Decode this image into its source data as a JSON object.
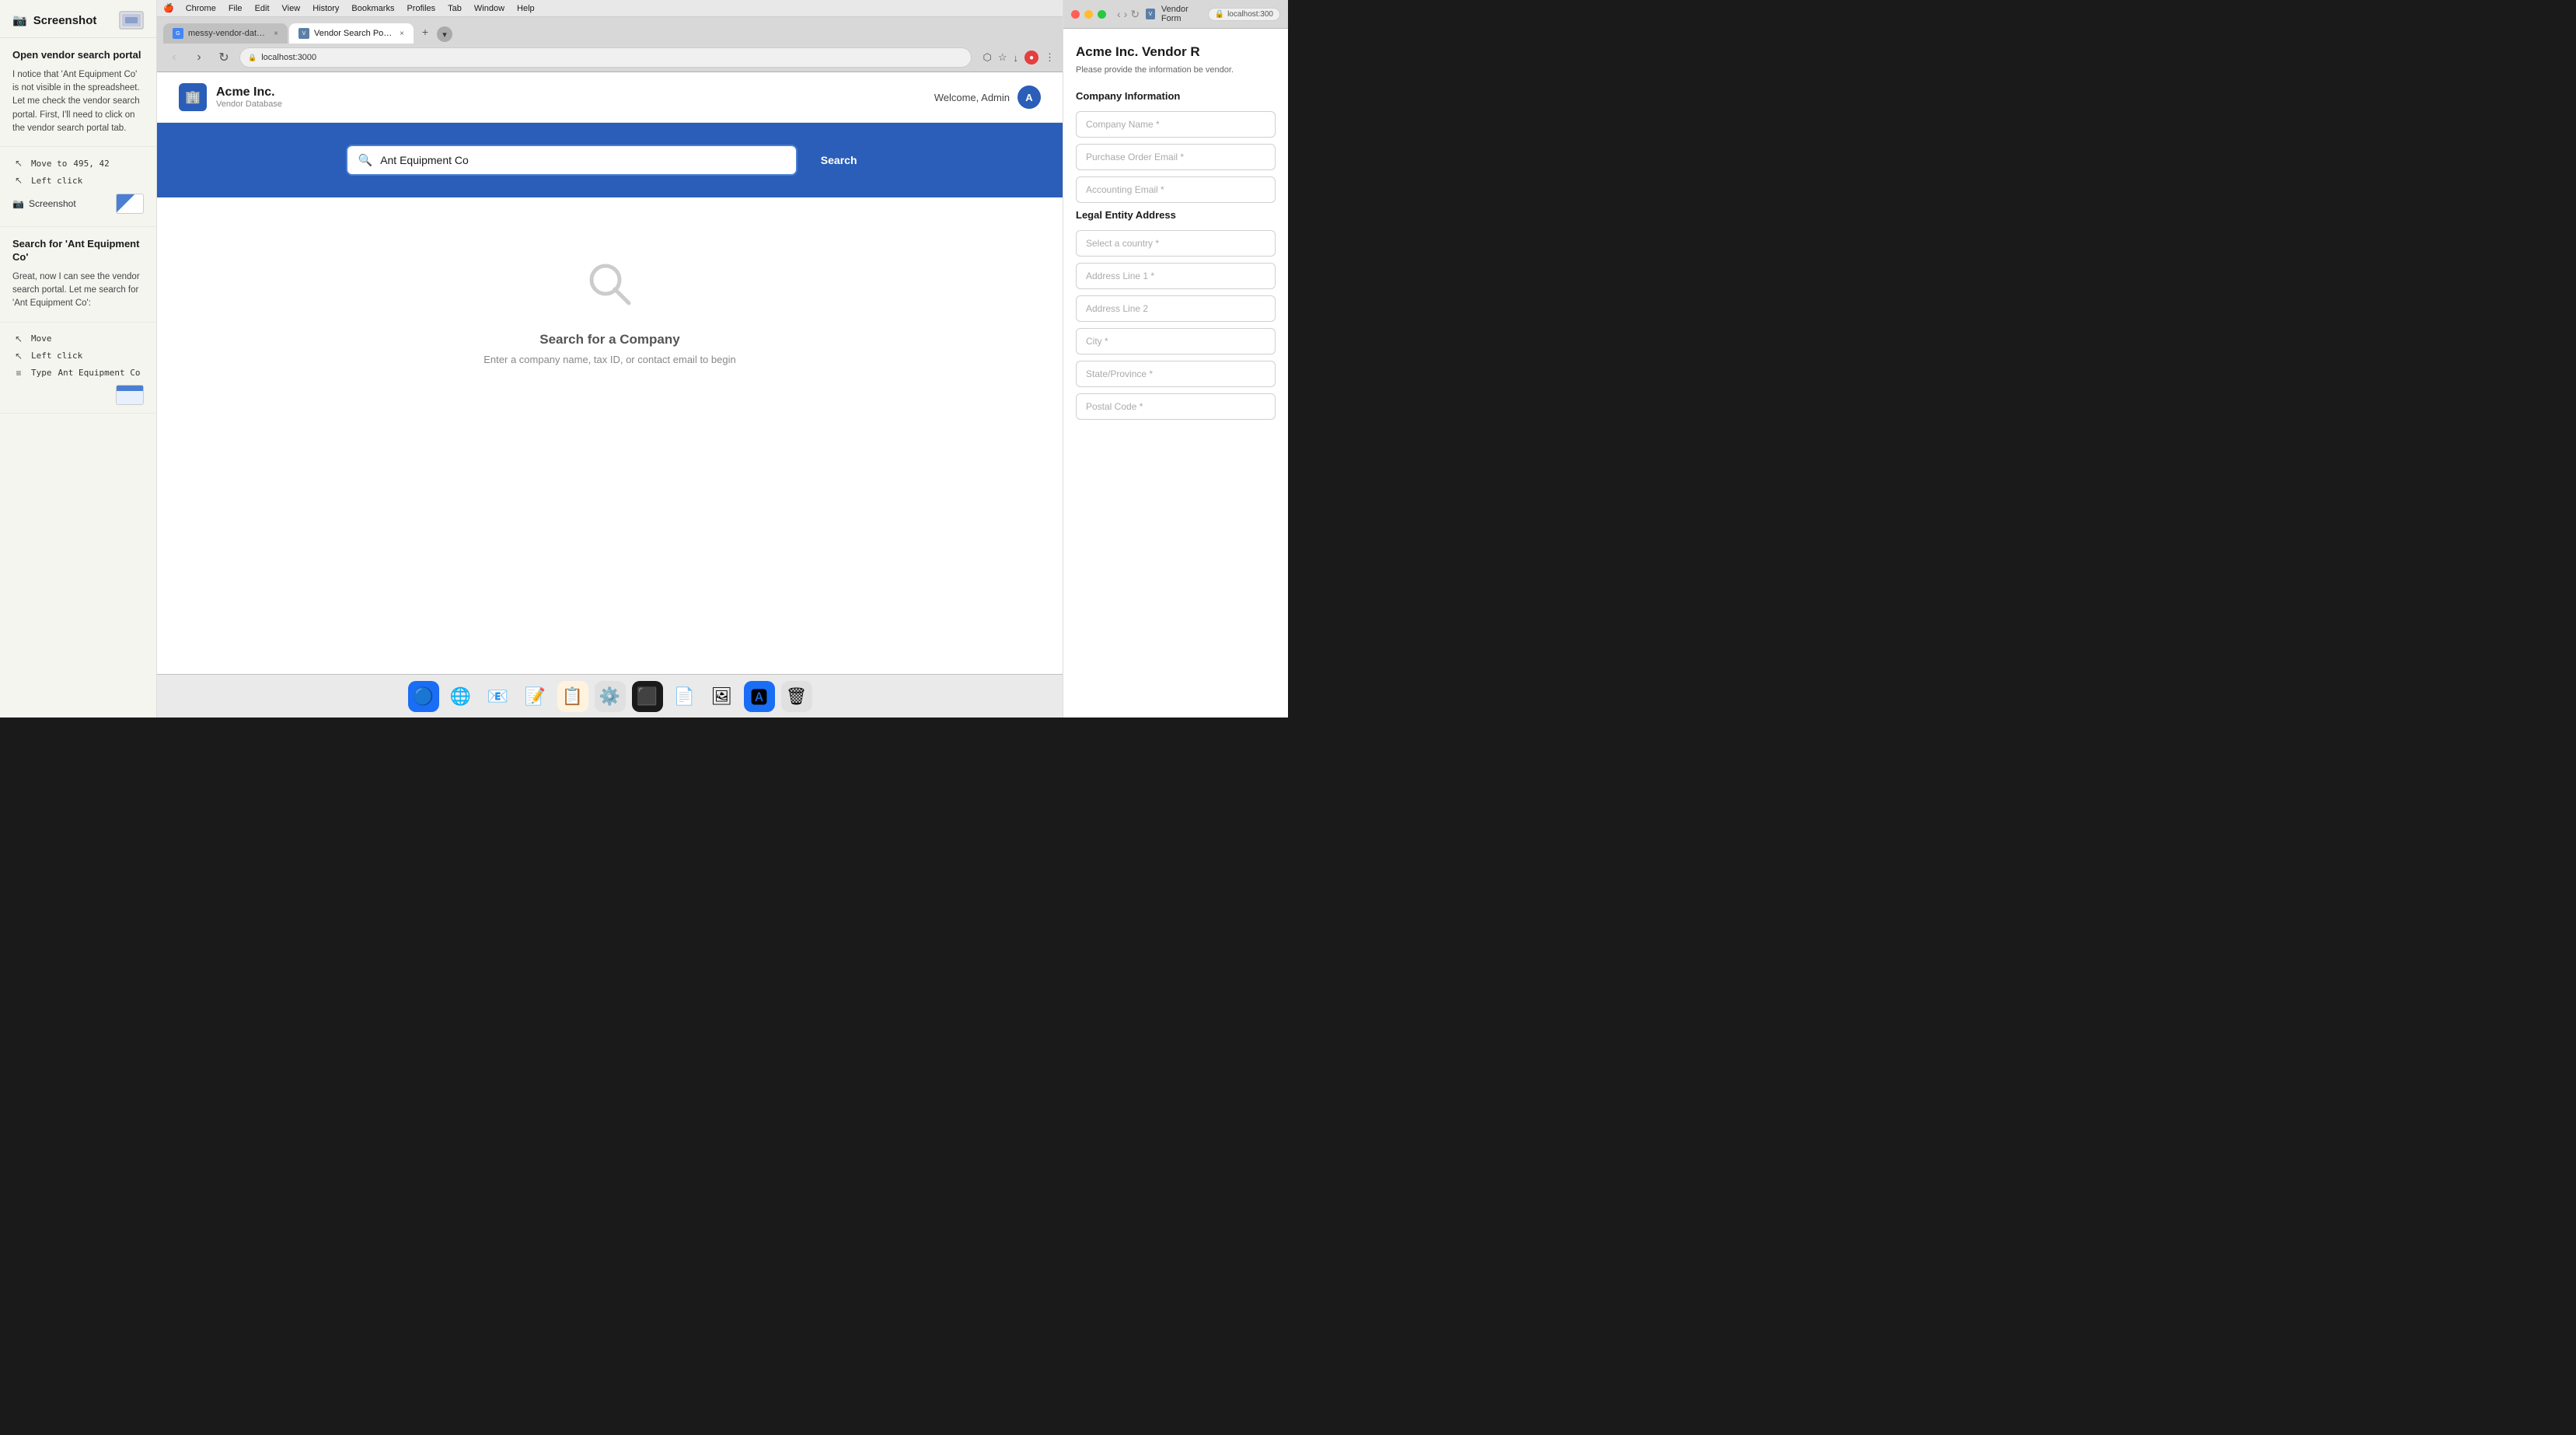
{
  "leftPanel": {
    "header": {
      "title": "Screenshot",
      "icon": "📷"
    },
    "sections": [
      {
        "id": "open-vendor",
        "title": "Open vendor search portal",
        "description": "I notice that 'Ant Equipment Co' is not visible in the spreadsheet. Let me check the vendor search portal. First, I'll need to click on the vendor search portal tab."
      },
      {
        "id": "actions-1",
        "actions": [
          {
            "type": "move",
            "icon": "↖",
            "label": "Move to",
            "value": "495, 42"
          },
          {
            "type": "click",
            "icon": "↖",
            "label": "Left click",
            "value": ""
          },
          {
            "type": "screenshot",
            "icon": "📷",
            "label": "Screenshot",
            "value": ""
          }
        ]
      },
      {
        "id": "search-vendor",
        "title": "Search for 'Ant Equipment Co'",
        "description": "Great, now I can see the vendor search portal. Let me search for 'Ant Equipment Co':"
      },
      {
        "id": "actions-2",
        "actions": [
          {
            "type": "move",
            "icon": "↖",
            "label": "Move",
            "value": ""
          },
          {
            "type": "click",
            "icon": "↖",
            "label": "Left click",
            "value": ""
          },
          {
            "type": "type",
            "icon": "≡",
            "label": "Type",
            "value": "Ant Equipment Co"
          }
        ]
      }
    ]
  },
  "macos": {
    "menuItems": [
      "Chrome",
      "File",
      "Edit",
      "View",
      "History",
      "Bookmarks",
      "Profiles",
      "Tab",
      "Window",
      "Help"
    ]
  },
  "browser": {
    "tabs": [
      {
        "id": "tab-sheets",
        "label": "messy-vendor-data - Google...",
        "favicon": "G",
        "active": false
      },
      {
        "id": "tab-vendor",
        "label": "Vendor Search Portal",
        "favicon": "V",
        "active": true
      }
    ],
    "url": "localhost:3000"
  },
  "vendorPortal": {
    "appName": "Acme Inc.",
    "appSubtitle": "Vendor Database",
    "welcomeText": "Welcome, Admin",
    "userInitial": "A",
    "searchPlaceholder": "Ant Equipment Co",
    "searchButtonLabel": "Search",
    "emptyStateTitle": "Search for a Company",
    "emptyStateDesc": "Enter a company name, tax ID, or contact email to begin"
  },
  "rightPanel": {
    "title": "Vendor Form",
    "url": "localhost:300",
    "pageTitle": "Acme Inc. Vendor R",
    "pageDesc": "Please provide the information be vendor.",
    "sections": [
      {
        "id": "company-info",
        "title": "Company Information",
        "fields": [
          {
            "label": "Company Name",
            "required": true
          },
          {
            "label": "Purchase Order Email",
            "required": true
          },
          {
            "label": "Accounting Email",
            "required": true
          }
        ]
      },
      {
        "id": "legal-address",
        "title": "Legal Entity Address",
        "fields": [
          {
            "label": "Select a country",
            "required": true
          },
          {
            "label": "Address Line 1",
            "required": true
          },
          {
            "label": "Address Line 2",
            "required": false
          },
          {
            "label": "City",
            "required": true
          },
          {
            "label": "State/Province",
            "required": true
          },
          {
            "label": "Postal Code",
            "required": true
          }
        ]
      }
    ]
  },
  "dock": {
    "icons": [
      {
        "id": "finder",
        "emoji": "🔵",
        "label": "Finder"
      },
      {
        "id": "chrome",
        "emoji": "🌐",
        "label": "Chrome"
      },
      {
        "id": "mail",
        "emoji": "📧",
        "label": "Mail"
      },
      {
        "id": "notes",
        "emoji": "📝",
        "label": "Notes"
      },
      {
        "id": "terminal",
        "emoji": "⬛",
        "label": "Terminal"
      },
      {
        "id": "textedit",
        "emoji": "📄",
        "label": "TextEdit"
      },
      {
        "id": "trash",
        "emoji": "🗑",
        "label": "Trash"
      }
    ]
  }
}
